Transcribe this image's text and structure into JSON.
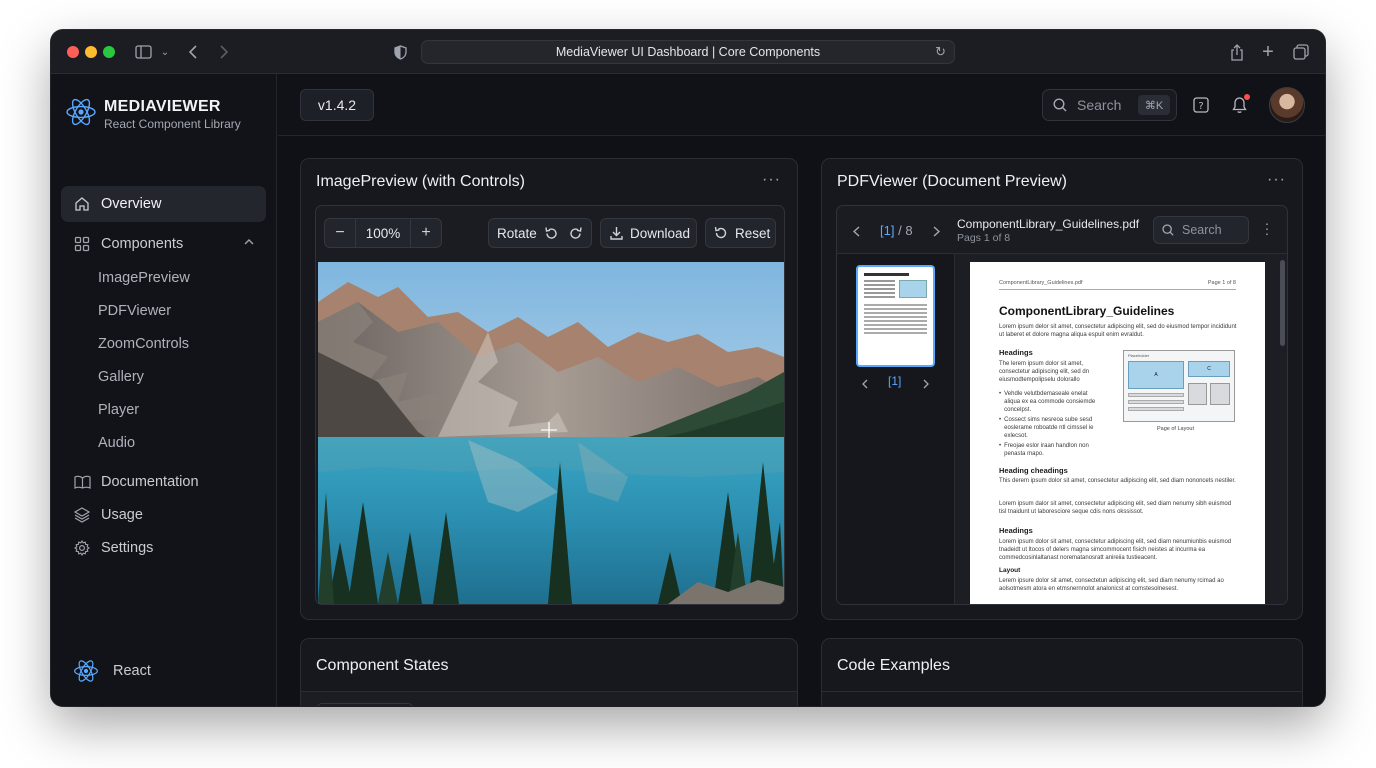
{
  "browser": {
    "url_title": "MediaViewer UI Dashboard | Core Components"
  },
  "brand": {
    "title": "MEDIAVIEWER",
    "subtitle": "React Component Library"
  },
  "nav": {
    "overview": "Overview",
    "components": "Components",
    "sub_items": [
      "ImagePreview",
      "PDFViewer",
      "ZoomControls",
      "Gallery",
      "Player",
      "Audio"
    ],
    "documentation": "Documentation",
    "usage": "Usage",
    "settings": "Settings",
    "footer": "React"
  },
  "header": {
    "version": "v1.4.2",
    "search_placeholder": "Search",
    "search_shortcut": "⌘K"
  },
  "image_preview": {
    "title": "ImagePreview (with Controls)",
    "zoom_value": "100%",
    "rotate_label": "Rotate",
    "download_label": "Download",
    "reset_label": "Reset"
  },
  "pdf_viewer": {
    "title": "PDFViewer (Document Preview)",
    "page_current": "[1]",
    "page_total": "/ 8",
    "file_name": "ComponentLibrary_Guidelines.pdf",
    "page_info": "Pags 1 of 8",
    "search_placeholder": "Search",
    "thumb_page": "[1]",
    "doc": {
      "running_head_left": "ComponentLibrary_Guidelines.pdf",
      "running_head_right": "Page 1 of 8",
      "heading": "ComponentLibrary_Guidelines",
      "intro": "Lorem ipsum delor sit amet, consectetur adipiscing elit, sed do eiusmod tempor incididunt ut laberet et dolore magna aliqua espuit enim evraldut.",
      "h_headings": "Headings",
      "p1": "The lerem ipsum dolor sit amet, consectetur adipiscing elit, sed dn eiusmodtempolipselu dolorallo",
      "bullets": [
        "Vehdle velutbdemaseale enelat aliqua ex ea commode consiemde concelpst.",
        "Cossect sims nesreoa sube sesd eoslerame roboatde ntl cimssel ie exlecsot.",
        "Freojae eslor iraan handlon non penasta mapo."
      ],
      "figure_caption": "Page of Layout",
      "figure_header": "Placeholder",
      "figure_a": "A",
      "figure_c": "C",
      "h_heading_cheadings": "Heading cheadings",
      "p2": "This derem ipsum dolor sit amet, consectetur adipiscing elit, sed diam nononcets nestiler.",
      "p3": "Lorem ipsum dalor sit amet, consectetur adipiscing elit, sed diam nenumy sibh euismod tisl tnaidunt ut laboresciore seque cdis nons okssissot.",
      "h_headings2": "Headings",
      "p4": "Lorem ipsum dolor sit amet, consectetur adipiscing elit, sed diam nenumiunbis euismod tnadeidt ut ltocos of delers magna simcommocent fisich neistes at incurma ea commedcosinlaltanast norematanosratt anireiia tustieacent.",
      "h_layout": "Layout",
      "p5": "Lerem ipsure dolor sit amet, consectetun adipiscing elit, sed diam nenumy rcimad ao aolsotmesm atora en etmsnernnolot analonicst at comstesolnesest."
    }
  },
  "bottom": {
    "states_title": "Component States",
    "code_title": "Code Examples"
  },
  "colors": {
    "window_bg": "#0f1116",
    "card_bg": "#16181e",
    "accent": "#5aa9ff",
    "notification": "#ff4d4f"
  }
}
